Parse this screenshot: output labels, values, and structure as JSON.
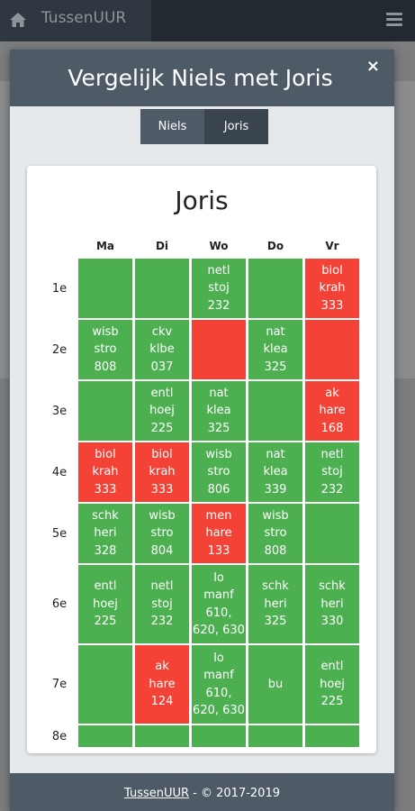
{
  "app": {
    "brand": "TussenUUR",
    "icons": {
      "home": "home-icon",
      "menu": "hamburger-menu-icon",
      "close": "close-icon"
    }
  },
  "modal": {
    "title": "Vergelijk Niels met Joris",
    "close_label": "×",
    "tabs": [
      {
        "label": "Niels",
        "active": false
      },
      {
        "label": "Joris",
        "active": true
      }
    ]
  },
  "schedule": {
    "title": "Joris",
    "days": [
      "Ma",
      "Di",
      "Wo",
      "Do",
      "Vr"
    ],
    "periods": [
      "1e",
      "2e",
      "3e",
      "4e",
      "5e",
      "6e",
      "7e",
      "8e"
    ],
    "status_colors": {
      "free": "#4caf50",
      "busy": "#f44336"
    },
    "rows": [
      [
        {
          "text": "",
          "status": "free"
        },
        {
          "text": "",
          "status": "free"
        },
        {
          "text": "netl\nstoj\n232",
          "status": "free"
        },
        {
          "text": "",
          "status": "free"
        },
        {
          "text": "biol\nkrah\n333",
          "status": "busy"
        }
      ],
      [
        {
          "text": "wisb\nstro\n808",
          "status": "free"
        },
        {
          "text": "ckv\nklbe\n037",
          "status": "free"
        },
        {
          "text": "",
          "status": "busy"
        },
        {
          "text": "nat\nklea\n325",
          "status": "free"
        },
        {
          "text": "",
          "status": "busy"
        }
      ],
      [
        {
          "text": "",
          "status": "free"
        },
        {
          "text": "entl\nhoej\n225",
          "status": "free"
        },
        {
          "text": "nat\nklea\n325",
          "status": "free"
        },
        {
          "text": "",
          "status": "free"
        },
        {
          "text": "ak\nhare\n168",
          "status": "busy"
        }
      ],
      [
        {
          "text": "biol\nkrah\n333",
          "status": "busy"
        },
        {
          "text": "biol\nkrah\n333",
          "status": "busy"
        },
        {
          "text": "wisb\nstro\n806",
          "status": "free"
        },
        {
          "text": "nat\nklea\n339",
          "status": "free"
        },
        {
          "text": "netl\nstoj\n232",
          "status": "free"
        }
      ],
      [
        {
          "text": "schk\nheri\n328",
          "status": "free"
        },
        {
          "text": "wisb\nstro\n804",
          "status": "free"
        },
        {
          "text": "men\nhare\n133",
          "status": "busy"
        },
        {
          "text": "wisb\nstro\n808",
          "status": "free"
        },
        {
          "text": "",
          "status": "free"
        }
      ],
      [
        {
          "text": "entl\nhoej\n225",
          "status": "free"
        },
        {
          "text": "netl\nstoj\n232",
          "status": "free"
        },
        {
          "text": "lo\nmanf\n610,\n620, 630",
          "status": "free"
        },
        {
          "text": "schk\nheri\n325",
          "status": "free"
        },
        {
          "text": "schk\nheri\n330",
          "status": "free"
        }
      ],
      [
        {
          "text": "",
          "status": "free"
        },
        {
          "text": "ak\nhare\n124",
          "status": "busy"
        },
        {
          "text": "lo\nmanf\n610,\n620, 630",
          "status": "free"
        },
        {
          "text": "bu",
          "status": "free"
        },
        {
          "text": "entl\nhoej\n225",
          "status": "free"
        }
      ],
      [
        {
          "text": "",
          "status": "free"
        },
        {
          "text": "",
          "status": "free"
        },
        {
          "text": "",
          "status": "free"
        },
        {
          "text": "",
          "status": "free"
        },
        {
          "text": "",
          "status": "free"
        }
      ]
    ]
  },
  "footer": {
    "link": "TussenUUR",
    "text": " - © 2017-2019"
  }
}
